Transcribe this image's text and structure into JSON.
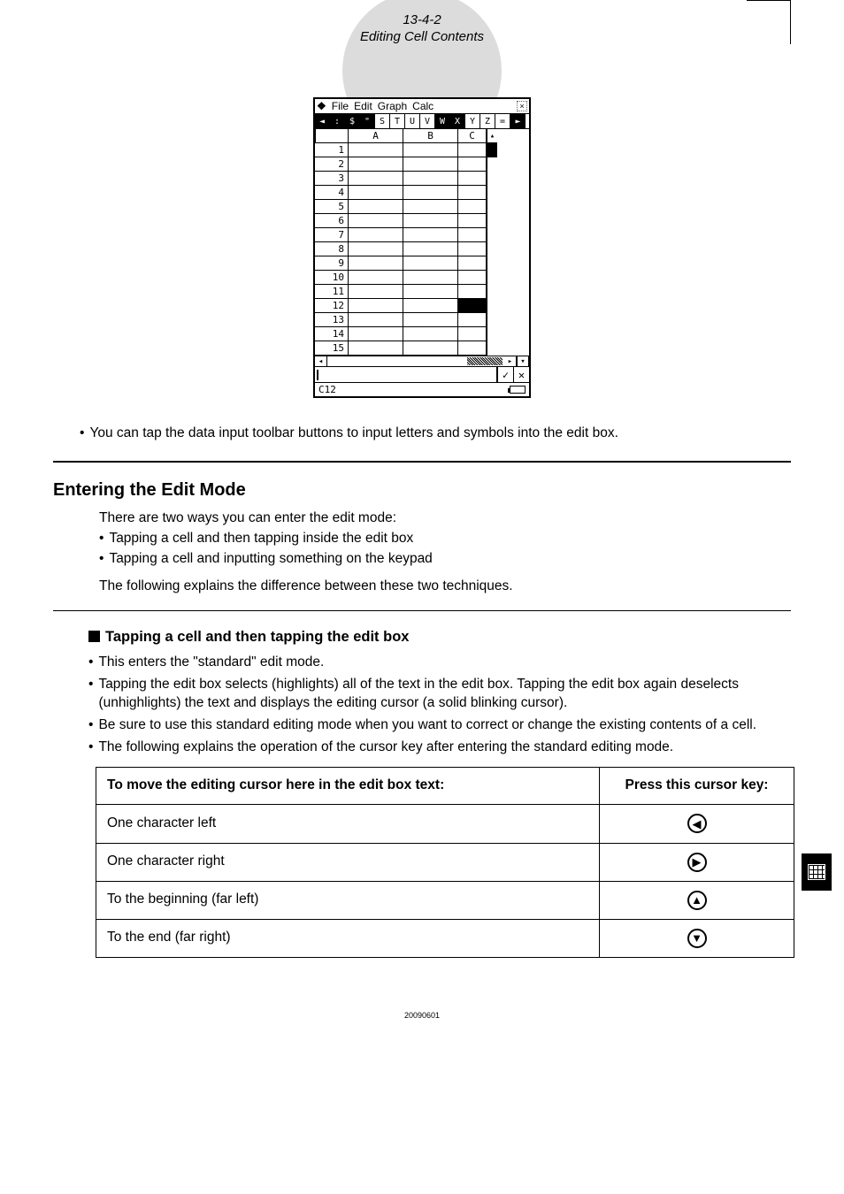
{
  "header": {
    "number": "13-4-2",
    "title": "Editing Cell Contents"
  },
  "device": {
    "menu": {
      "file": "File",
      "edit": "Edit",
      "graph": "Graph",
      "calc": "Calc"
    },
    "toolbar": [
      "◄",
      ":",
      "$",
      "\"",
      "S",
      "T",
      "U",
      "V",
      "W",
      "X",
      "Y",
      "Z",
      "=",
      "►"
    ],
    "toolbar_dark_indices": [
      0,
      1,
      2,
      3,
      8,
      9,
      13
    ],
    "columns": [
      "A",
      "B",
      "C"
    ],
    "rows": [
      "1",
      "2",
      "3",
      "4",
      "5",
      "6",
      "7",
      "8",
      "9",
      "10",
      "11",
      "12",
      "13",
      "14",
      "15"
    ],
    "selected_cell_ref": "C12"
  },
  "line_after_screenshot": "You can tap the data input toolbar buttons to input letters and symbols into the edit box.",
  "section1": {
    "heading": "Entering the Edit Mode",
    "intro": "There are two ways you can enter the edit mode:",
    "bullets": [
      "Tapping a cell and then tapping inside the edit box",
      "Tapping a cell and inputting something on the keypad"
    ],
    "followup": "The following explains the difference between these two techniques."
  },
  "section2": {
    "heading": "Tapping a cell and then tapping the edit box",
    "bullets": [
      "This enters the \"standard\" edit mode.",
      "Tapping the edit box selects (highlights) all of the text in the edit box. Tapping the edit box again deselects (unhighlights) the text and displays the editing cursor (a solid blinking cursor).",
      "Be sure to use this standard editing mode when you want to correct or change the existing contents of a cell.",
      "The following explains the operation of the cursor key after entering the standard editing mode."
    ]
  },
  "table": {
    "head_left": "To move the editing cursor here in the edit box text:",
    "head_right": "Press this cursor key:",
    "rows": [
      {
        "left": "One character left",
        "key": "◀"
      },
      {
        "left": "One character right",
        "key": "▶"
      },
      {
        "left": "To the beginning (far left)",
        "key": "▲"
      },
      {
        "left": "To the end (far right)",
        "key": "▼"
      }
    ]
  },
  "footer": "20090601"
}
